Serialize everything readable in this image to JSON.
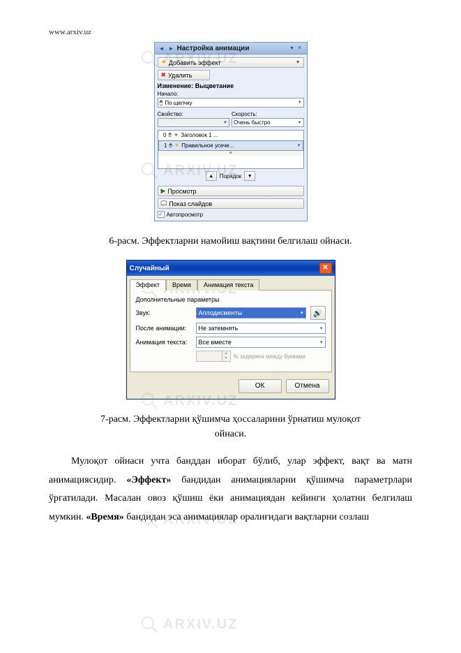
{
  "header": {
    "url": "www.arxiv.uz"
  },
  "watermark": {
    "text": "ARXIV.UZ"
  },
  "taskpane": {
    "title": "Настройка анимации",
    "add_effect": "Добавить эффект",
    "remove": "Удалить",
    "change_label": "Изменение: Выцветание",
    "start_label": "Начало:",
    "start_value": "По щелчку",
    "property_label": "Свойство:",
    "speed_label": "Скорость:",
    "speed_value": "Очень быстро",
    "list": {
      "row0_num": "0",
      "row0_text": "Заголовок 1 ...",
      "row1_num": "1",
      "row1_text": "Правильное усече..."
    },
    "reorder_label": "Порядок",
    "play": "Просмотр",
    "slideshow": "Показ слайдов",
    "autopreview": "Автопросмотр"
  },
  "caption1": "6-расм. Эффектларни намойиш вақтини белгилаш ойнаси.",
  "dialog": {
    "title": "Случайный",
    "tab_effect": "Эффект",
    "tab_time": "Время",
    "tab_textanim": "Анимация текста",
    "group": "Дополнительные параметры",
    "sound_label": "Звук:",
    "sound_value": "Аплодисменты",
    "after_label": "После анимации:",
    "after_value": "Не затемнять",
    "textanim_label": "Анимация текста:",
    "textanim_value": "Все вместе",
    "delay_hint": "% задержка между буквами",
    "ok": "ОК",
    "cancel": "Отмена"
  },
  "caption2_line1": "7-расм. Эффектларни қўшимча ҳоссаларини ўрнатиш мулоқот",
  "caption2_line2": "ойнаси.",
  "paragraph": {
    "p1_a": "Мулоқот ойнаси учта банддан иборат бўлиб, улар эффект, вақт ва матн анимациясидир. ",
    "b1": "«Эффект»",
    "p1_b": " бандидан анимацияларни қўшимча параметрлари ўргатилади. Масалан овоз қўшиш ёки  анимациядан кейинги ҳолатни белгилаш мумкин. ",
    "b2": "«Время»",
    "p1_c": " бандидан эса анимациялар оралиғидаги вақтларни созлаш"
  }
}
